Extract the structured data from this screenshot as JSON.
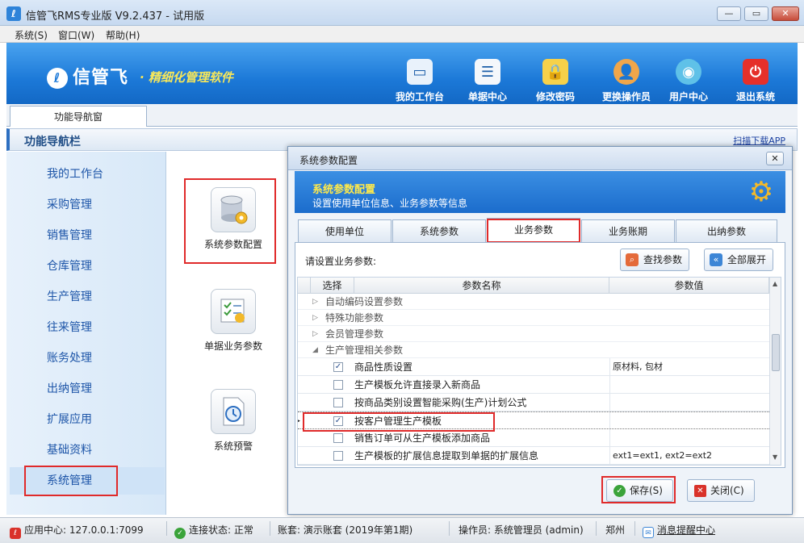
{
  "window": {
    "title": "信管飞RMS专业版 V9.2.437 - 试用版",
    "app_icon": "app-logo-icon"
  },
  "menu": [
    {
      "label": "系统(S)"
    },
    {
      "label": "窗口(W)"
    },
    {
      "label": "帮助(H)"
    }
  ],
  "banner": {
    "brand": "信管飞",
    "slogan": "· 精细化管理软件",
    "toolbar": [
      {
        "label": "我的工作台",
        "icon": "monitor-icon"
      },
      {
        "label": "单据中心",
        "icon": "list-icon"
      },
      {
        "label": "修改密码",
        "icon": "lock-icon"
      },
      {
        "label": "更换操作员",
        "icon": "user-icon"
      },
      {
        "label": "用户中心",
        "icon": "globe-icon"
      },
      {
        "label": "退出系统",
        "icon": "power-icon"
      }
    ]
  },
  "tabs": [
    {
      "label": "功能导航窗"
    }
  ],
  "nav": {
    "title": "功能导航栏",
    "app_link": "扫描下载APP"
  },
  "sidebar": {
    "items": [
      {
        "label": "我的工作台"
      },
      {
        "label": "采购管理"
      },
      {
        "label": "销售管理"
      },
      {
        "label": "仓库管理"
      },
      {
        "label": "生产管理"
      },
      {
        "label": "往来管理"
      },
      {
        "label": "账务处理"
      },
      {
        "label": "出纳管理"
      },
      {
        "label": "扩展应用"
      },
      {
        "label": "基础资料"
      },
      {
        "label": "系统管理"
      }
    ],
    "selected": "系统管理"
  },
  "content": {
    "items": [
      {
        "label": "系统参数配置",
        "icon": "database-gear-icon"
      },
      {
        "label": "单据业务参数",
        "icon": "checklist-icon"
      },
      {
        "label": "系统预警",
        "icon": "clock-icon"
      }
    ]
  },
  "dialog": {
    "title": "系统参数配置",
    "header_title": "系统参数配置",
    "header_desc": "设置使用单位信息、业务参数等信息",
    "tabs": [
      {
        "label": "使用单位"
      },
      {
        "label": "系统参数"
      },
      {
        "label": "业务参数"
      },
      {
        "label": "业务账期"
      },
      {
        "label": "出纳参数"
      }
    ],
    "selected_tab": "业务参数",
    "prompt": "请设置业务参数:",
    "find_button": "查找参数",
    "expand_button": "全部展开",
    "grid": {
      "headers": [
        "选择",
        "参数名称",
        "参数值"
      ],
      "groups": [
        {
          "label": "自动编码设置参数"
        },
        {
          "label": "特殊功能参数"
        },
        {
          "label": "会员管理参数"
        },
        {
          "label": "生产管理相关参数"
        }
      ],
      "items": [
        {
          "name": "商品性质设置",
          "checked": true,
          "value": "原材料, 包材"
        },
        {
          "name": "生产模板允许直接录入新商品",
          "checked": false,
          "value": ""
        },
        {
          "name": "按商品类别设置智能采购(生产)计划公式",
          "checked": false,
          "value": ""
        },
        {
          "name": "按客户管理生产模板",
          "checked": true,
          "value": ""
        },
        {
          "name": "销售订单可从生产模板添加商品",
          "checked": false,
          "value": ""
        },
        {
          "name": "生产模板的扩展信息提取到单据的扩展信息",
          "checked": false,
          "value": "ext1=ext1, ext2=ext2"
        }
      ]
    },
    "save_button": "保存(S)",
    "close_button": "关闭(C)"
  },
  "status": {
    "app_center": "应用中心: 127.0.0.1:7099",
    "connection": "连接状态: 正常",
    "account": "账套: 演示账套 (2019年第1期)",
    "operator": "操作员: 系统管理员 (admin)",
    "city": "郑州",
    "message_center": "消息提醒中心"
  }
}
